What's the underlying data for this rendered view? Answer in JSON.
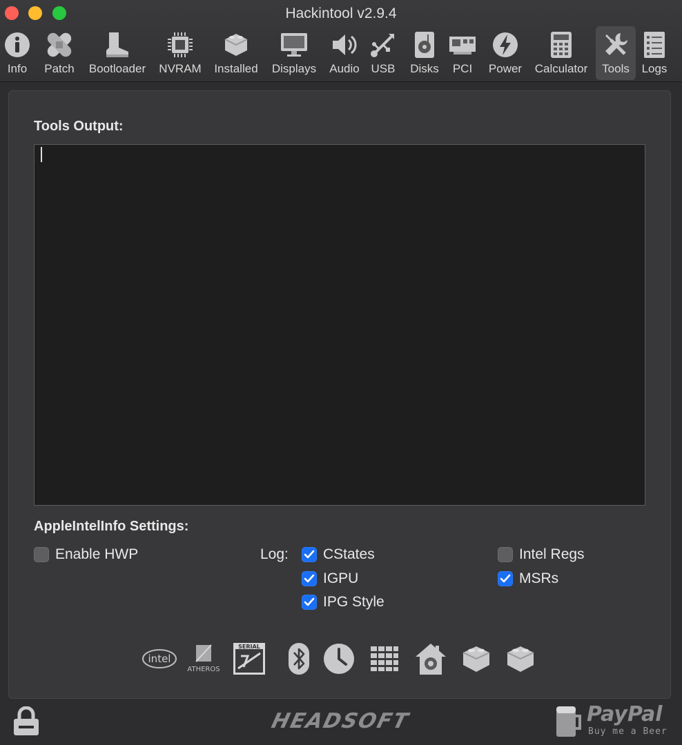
{
  "window": {
    "title": "Hackintool v2.9.4"
  },
  "toolbar": {
    "items": [
      {
        "label": "Info",
        "icon": "info-icon"
      },
      {
        "label": "Patch",
        "icon": "bandage-icon"
      },
      {
        "label": "Bootloader",
        "icon": "boot-icon"
      },
      {
        "label": "NVRAM",
        "icon": "chip-icon"
      },
      {
        "label": "Installed",
        "icon": "kext-brick-icon"
      },
      {
        "label": "Displays",
        "icon": "monitor-icon"
      },
      {
        "label": "Audio",
        "icon": "speaker-icon"
      },
      {
        "label": "USB",
        "icon": "usb-icon"
      },
      {
        "label": "Disks",
        "icon": "disk-icon"
      },
      {
        "label": "PCI",
        "icon": "pci-card-icon"
      },
      {
        "label": "Power",
        "icon": "power-bolt-icon"
      },
      {
        "label": "Calculator",
        "icon": "calculator-icon"
      },
      {
        "label": "Tools",
        "icon": "wrench-icon"
      },
      {
        "label": "Logs",
        "icon": "log-list-icon"
      }
    ],
    "selected": "Tools"
  },
  "tools": {
    "output_title": "Tools Output:",
    "output_text": "",
    "settings_title": "AppleIntelInfo Settings:",
    "log_label": "Log:",
    "options": {
      "enable_hwp": {
        "label": "Enable HWP",
        "checked": false
      },
      "cstates": {
        "label": "CStates",
        "checked": true
      },
      "igpu": {
        "label": "IGPU",
        "checked": true
      },
      "ipg_style": {
        "label": "IPG Style",
        "checked": true
      },
      "intel_regs": {
        "label": "Intel Regs",
        "checked": false
      },
      "msrs": {
        "label": "MSRs",
        "checked": true
      }
    },
    "tool_icons": [
      {
        "name": "intel-logo-icon",
        "text": "intel"
      },
      {
        "name": "atheros-logo-icon",
        "text": "ATHEROS"
      },
      {
        "name": "serial-ata-icon",
        "text": "SERIAL"
      },
      {
        "name": "bluetooth-icon"
      },
      {
        "name": "clock-icon"
      },
      {
        "name": "grid-icon"
      },
      {
        "name": "home-lock-icon"
      },
      {
        "name": "kext-brick-icon"
      },
      {
        "name": "kext-brick-icon"
      }
    ]
  },
  "footer": {
    "brand": "HEADSOFT",
    "paypal": "PayPal",
    "paypal_sub": "Buy me a Beer"
  },
  "colors": {
    "accent": "#1a6ff4",
    "background": "#2d2d2f",
    "panel": "#38383a",
    "output_bg": "#1e1e1e"
  }
}
